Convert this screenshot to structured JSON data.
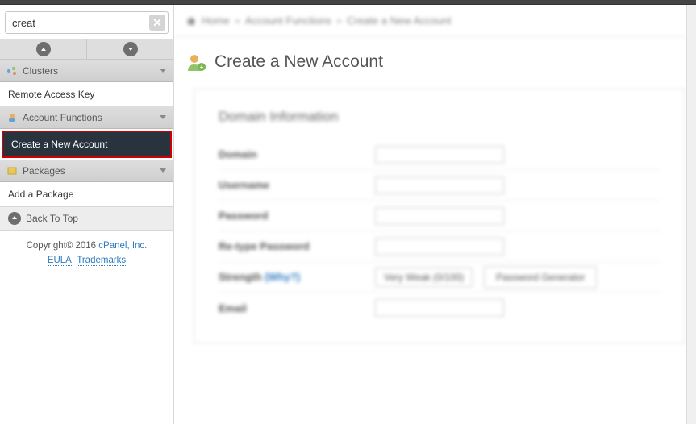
{
  "search": {
    "value": "creat"
  },
  "sections": {
    "clusters": {
      "label": "Clusters"
    },
    "account_functions": {
      "label": "Account Functions"
    },
    "packages": {
      "label": "Packages"
    }
  },
  "items": {
    "remote_access_key": "Remote Access Key",
    "create_account": "Create a New Account",
    "add_package": "Add a Package"
  },
  "back_to_top": "Back To Top",
  "footer": {
    "copyright": "Copyright© 2016 ",
    "cpanel": "cPanel, Inc.",
    "eula": "EULA",
    "trademarks": "Trademarks"
  },
  "breadcrumb": {
    "home": "Home",
    "af": "Account Functions",
    "cna": "Create a New Account"
  },
  "page_title": "Create a New Account",
  "card": {
    "title": "Domain Information",
    "domain": "Domain",
    "username": "Username",
    "password": "Password",
    "retype": "Re-type Password",
    "strength": "Strength ",
    "why": "(Why?)",
    "strength_val": "Very Weak (0/100)",
    "gen": "Password Generator",
    "email": "Email"
  }
}
